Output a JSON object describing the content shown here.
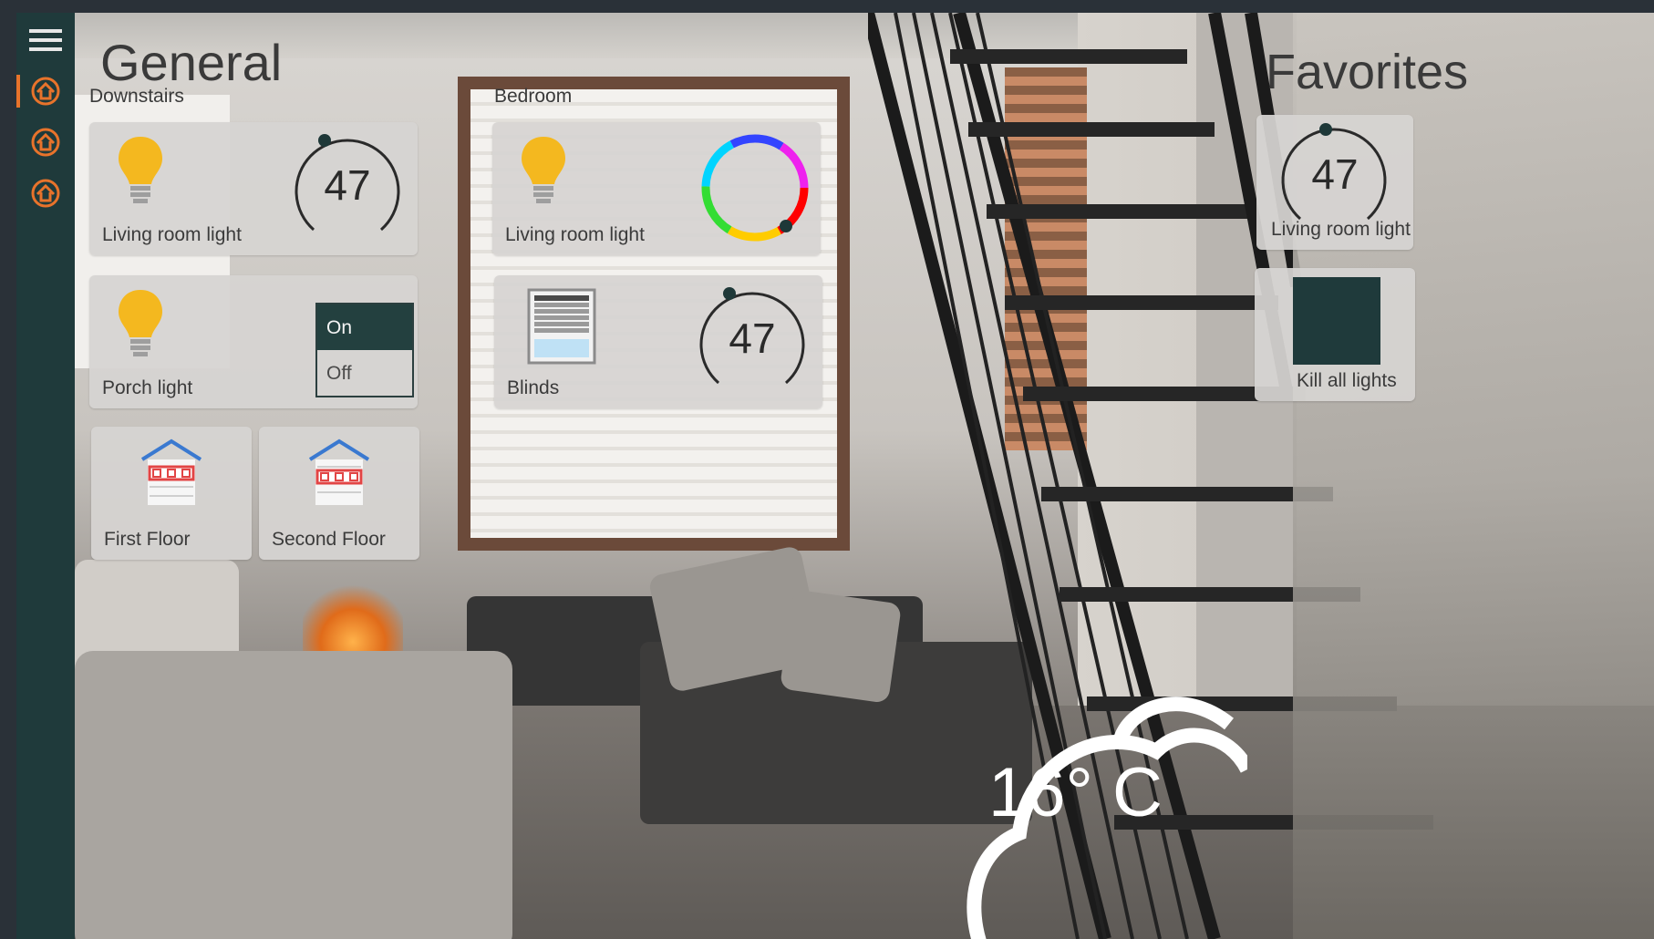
{
  "header": {
    "title": "General"
  },
  "favorites": {
    "title": "Favorites"
  },
  "groups": {
    "downstairs": "Downstairs",
    "bedroom": "Bedroom"
  },
  "tiles": {
    "downstairs_living_light": {
      "label": "Living room light",
      "value": "47",
      "icon": "bulb-icon"
    },
    "bedroom_living_light": {
      "label": "Living room light",
      "icon": "bulb-icon",
      "control": "color-wheel"
    },
    "porch_light": {
      "label": "Porch light",
      "icon": "bulb-icon",
      "toggle_on": "On",
      "toggle_off": "Off",
      "state": "On"
    },
    "blinds": {
      "label": "Blinds",
      "value": "47",
      "icon": "blinds-icon"
    },
    "first_floor": {
      "label": "First Floor",
      "icon": "house-icon"
    },
    "second_floor": {
      "label": "Second Floor",
      "icon": "house-icon"
    }
  },
  "favorite_tiles": {
    "living_light": {
      "label": "Living room light",
      "value": "47"
    },
    "kill_all": {
      "label": "Kill all lights"
    }
  },
  "weather": {
    "temperature": "16° C",
    "icon": "cloud-icon"
  },
  "sidebar": {
    "items": [
      {
        "name": "menu-icon"
      },
      {
        "name": "home-icon",
        "active": true
      },
      {
        "name": "home-icon"
      },
      {
        "name": "home-icon"
      }
    ]
  },
  "colors": {
    "sidebar": "#1f3a3b",
    "accent": "#e8732b",
    "bulb": "#f4b81f",
    "tile": "#d6d4d2",
    "toggle_on": "#23403f"
  }
}
